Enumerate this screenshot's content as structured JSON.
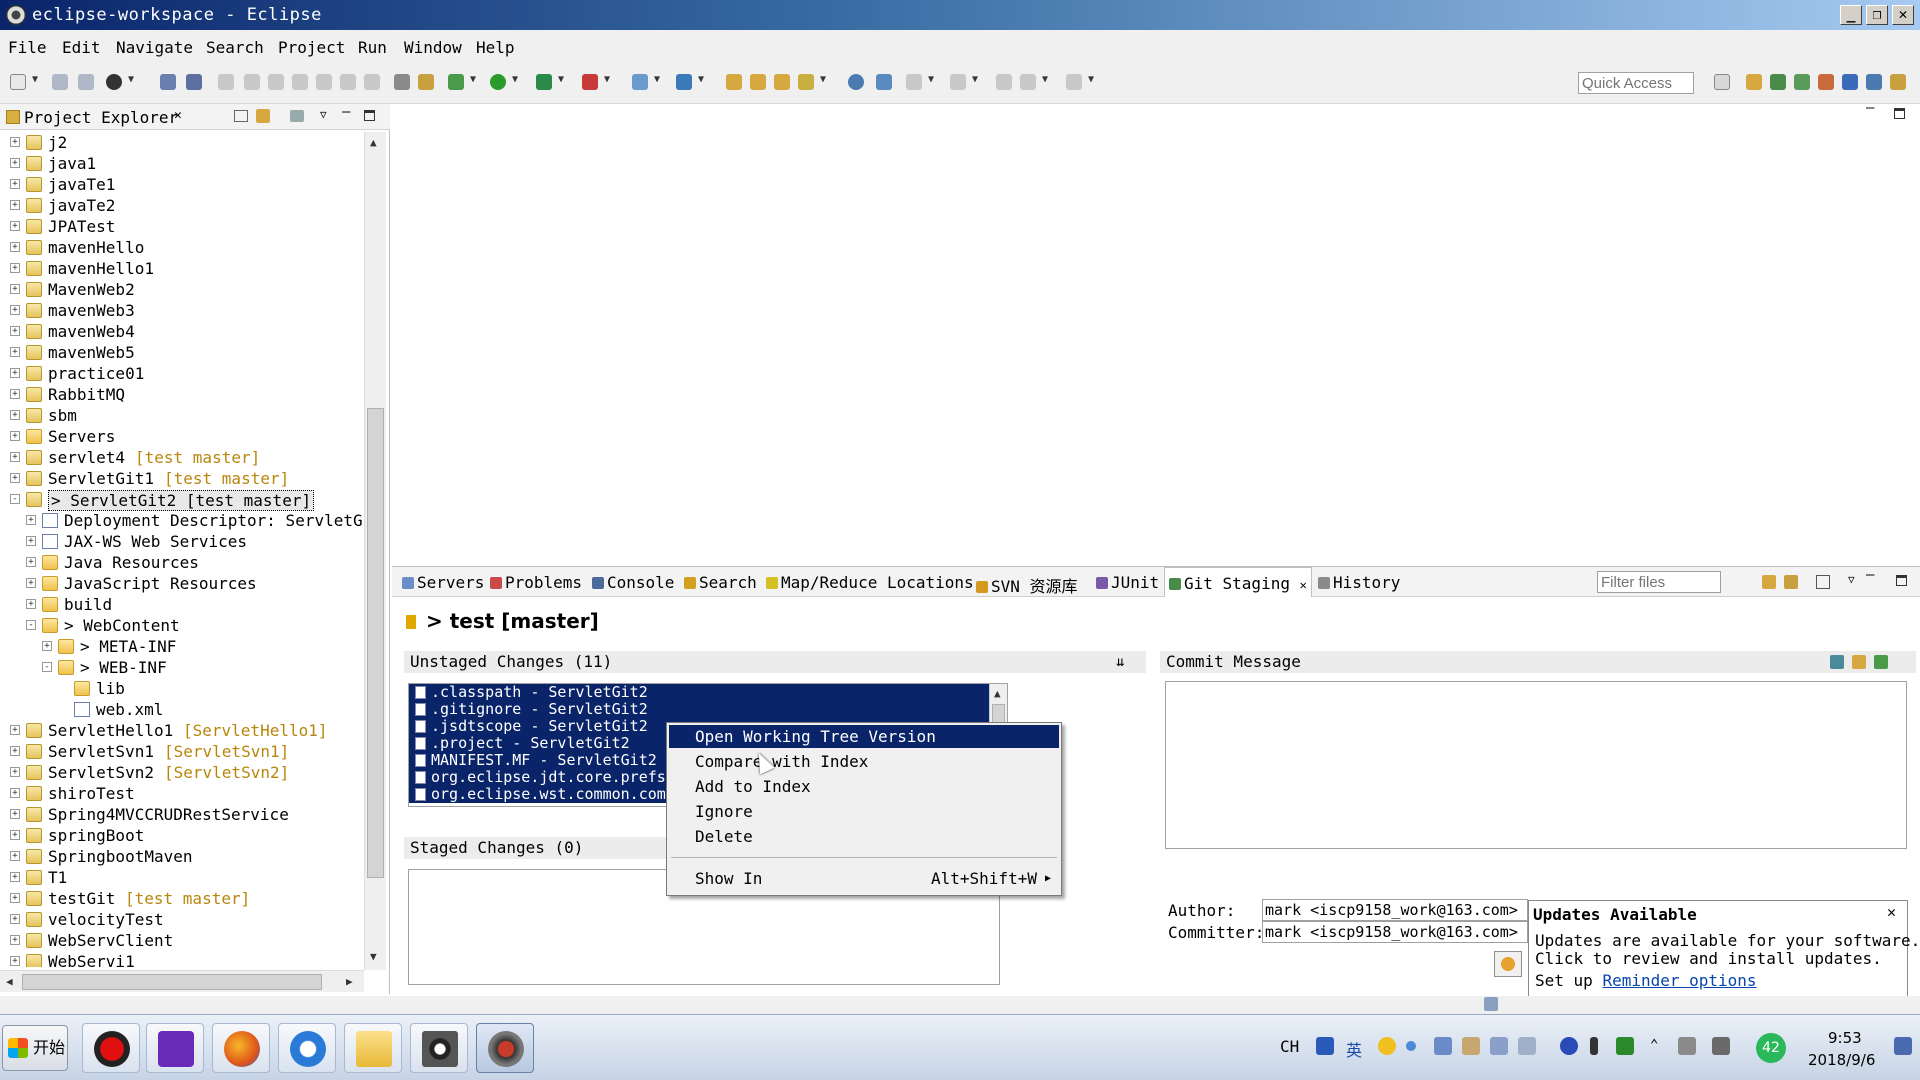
{
  "window": {
    "title": "eclipse-workspace - Eclipse"
  },
  "menu": [
    "File",
    "Edit",
    "Navigate",
    "Search",
    "Project",
    "Run",
    "Window",
    "Help"
  ],
  "toolbar": {
    "quick_access_placeholder": "Quick Access"
  },
  "explorer": {
    "tab_label": "Project Explorer",
    "items": [
      {
        "label": "j2",
        "deco": "",
        "level": 0,
        "expander": "+",
        "icon": "project"
      },
      {
        "label": "java1",
        "deco": "",
        "level": 0,
        "expander": "+",
        "icon": "project"
      },
      {
        "label": "javaTe1",
        "deco": "",
        "level": 0,
        "expander": "+",
        "icon": "project"
      },
      {
        "label": "javaTe2",
        "deco": "",
        "level": 0,
        "expander": "+",
        "icon": "project"
      },
      {
        "label": "JPATest",
        "deco": "",
        "level": 0,
        "expander": "+",
        "icon": "project"
      },
      {
        "label": "mavenHello",
        "deco": "",
        "level": 0,
        "expander": "+",
        "icon": "project"
      },
      {
        "label": "mavenHello1",
        "deco": "",
        "level": 0,
        "expander": "+",
        "icon": "project"
      },
      {
        "label": "MavenWeb2",
        "deco": "",
        "level": 0,
        "expander": "+",
        "icon": "project"
      },
      {
        "label": "mavenWeb3",
        "deco": "",
        "level": 0,
        "expander": "+",
        "icon": "project"
      },
      {
        "label": "mavenWeb4",
        "deco": "",
        "level": 0,
        "expander": "+",
        "icon": "project"
      },
      {
        "label": "mavenWeb5",
        "deco": "",
        "level": 0,
        "expander": "+",
        "icon": "project"
      },
      {
        "label": "practice01",
        "deco": "",
        "level": 0,
        "expander": "+",
        "icon": "project"
      },
      {
        "label": "RabbitMQ",
        "deco": "",
        "level": 0,
        "expander": "+",
        "icon": "project"
      },
      {
        "label": "sbm",
        "deco": "",
        "level": 0,
        "expander": "+",
        "icon": "project"
      },
      {
        "label": "Servers",
        "deco": "",
        "level": 0,
        "expander": "+",
        "icon": "folder"
      },
      {
        "label": "servlet4",
        "deco": "[test master]",
        "level": 0,
        "expander": "+",
        "icon": "project"
      },
      {
        "label": "ServletGit1",
        "deco": "[test master]",
        "level": 0,
        "expander": "+",
        "icon": "project"
      },
      {
        "label": "> ServletGit2 [test master]",
        "deco": "",
        "level": 0,
        "expander": "-",
        "icon": "project",
        "selected": true
      },
      {
        "label": "Deployment Descriptor: ServletGit",
        "deco": "",
        "level": 1,
        "expander": "+",
        "icon": "file"
      },
      {
        "label": "JAX-WS Web Services",
        "deco": "",
        "level": 1,
        "expander": "+",
        "icon": "file"
      },
      {
        "label": "Java Resources",
        "deco": "",
        "level": 1,
        "expander": "+",
        "icon": "folder"
      },
      {
        "label": "JavaScript Resources",
        "deco": "",
        "level": 1,
        "expander": "+",
        "icon": "folder"
      },
      {
        "label": "build",
        "deco": "",
        "level": 1,
        "expander": "+",
        "icon": "folder"
      },
      {
        "label": "> WebContent",
        "deco": "",
        "level": 1,
        "expander": "-",
        "icon": "folder"
      },
      {
        "label": "> META-INF",
        "deco": "",
        "level": 2,
        "expander": "+",
        "icon": "folder"
      },
      {
        "label": "> WEB-INF",
        "deco": "",
        "level": 2,
        "expander": "-",
        "icon": "folder"
      },
      {
        "label": "lib",
        "deco": "",
        "level": 3,
        "expander": "",
        "icon": "folder"
      },
      {
        "label": "web.xml",
        "deco": "",
        "level": 3,
        "expander": "",
        "icon": "file"
      },
      {
        "label": "ServletHello1",
        "deco": "[ServletHello1]",
        "level": 0,
        "expander": "+",
        "icon": "project"
      },
      {
        "label": "ServletSvn1",
        "deco": "[ServletSvn1]",
        "level": 0,
        "expander": "+",
        "icon": "project"
      },
      {
        "label": "ServletSvn2",
        "deco": "[ServletSvn2]",
        "level": 0,
        "expander": "+",
        "icon": "project"
      },
      {
        "label": "shiroTest",
        "deco": "",
        "level": 0,
        "expander": "+",
        "icon": "project"
      },
      {
        "label": "Spring4MVCCRUDRestService",
        "deco": "",
        "level": 0,
        "expander": "+",
        "icon": "project"
      },
      {
        "label": "springBoot",
        "deco": "",
        "level": 0,
        "expander": "+",
        "icon": "project"
      },
      {
        "label": "SpringbootMaven",
        "deco": "",
        "level": 0,
        "expander": "+",
        "icon": "project"
      },
      {
        "label": "T1",
        "deco": "",
        "level": 0,
        "expander": "+",
        "icon": "project"
      },
      {
        "label": "testGit",
        "deco": "[test master]",
        "level": 0,
        "expander": "+",
        "icon": "project"
      },
      {
        "label": "velocityTest",
        "deco": "",
        "level": 0,
        "expander": "+",
        "icon": "project"
      },
      {
        "label": "WebServClient",
        "deco": "",
        "level": 0,
        "expander": "+",
        "icon": "project"
      },
      {
        "label": "WebServi1",
        "deco": "",
        "level": 0,
        "expander": "+",
        "icon": "project"
      }
    ]
  },
  "bottom_tabs": [
    {
      "label": "Servers",
      "active": false,
      "color": "#6a8fc8"
    },
    {
      "label": "Problems",
      "active": false,
      "color": "#c84a4a"
    },
    {
      "label": "Console",
      "active": false,
      "color": "#4a6a9a"
    },
    {
      "label": "Search",
      "active": false,
      "color": "#d4a020"
    },
    {
      "label": "Map/Reduce Locations",
      "active": false,
      "color": "#d4c020"
    },
    {
      "label": "SVN 资源库",
      "active": false,
      "color": "#d49a20"
    },
    {
      "label": "JUnit",
      "active": false,
      "color": "#7a5aa8"
    },
    {
      "label": "Git Staging",
      "active": true,
      "color": "#4a8a4a"
    },
    {
      "label": "History",
      "active": false,
      "color": "#8a8a8a"
    }
  ],
  "git_staging": {
    "filter_placeholder": "Filter files",
    "repo_title": "> test [master]",
    "unstaged_header": "Unstaged Changes (11)",
    "unstaged_files": [
      ".classpath - ServletGit2",
      ".gitignore - ServletGit2",
      ".jsdtscope - ServletGit2",
      ".project - ServletGit2",
      "MANIFEST.MF - ServletGit2",
      "org.eclipse.jdt.core.prefs - ServletGit2",
      "org.eclipse.wst.common.component - ServletGit2"
    ],
    "staged_header": "Staged Changes (0)",
    "commit_message_header": "Commit Message",
    "author_label": "Author:",
    "author_value": "mark <iscp9158_work@163.com>",
    "committer_label": "Committer:",
    "committer_value": "mark <iscp9158_work@163.com>"
  },
  "context_menu": {
    "items": [
      {
        "label": "Open Working Tree Version",
        "highlighted": true
      },
      {
        "label": "Compare with Index",
        "highlighted": false
      },
      {
        "label": "Add to Index",
        "highlighted": false
      },
      {
        "label": "Ignore",
        "highlighted": false
      },
      {
        "label": "Delete",
        "highlighted": false
      }
    ],
    "show_in": {
      "label": "Show In",
      "accel": "Alt+Shift+W"
    }
  },
  "updates": {
    "title": "Updates Available",
    "line1": "Updates are available for your software.",
    "line2": "Click to review and install updates.",
    "line3_prefix": "Set up ",
    "line3_link": "Reminder options"
  },
  "taskbar": {
    "start_label": "开始",
    "tray_lang": "CH",
    "tray_ime": "英",
    "tray_badge": "42",
    "time": "9:53",
    "date": "2018/9/6"
  },
  "colors": {
    "selection": "#0a246a",
    "decoration": "#b8860b",
    "titlebar": "#0a246a"
  }
}
